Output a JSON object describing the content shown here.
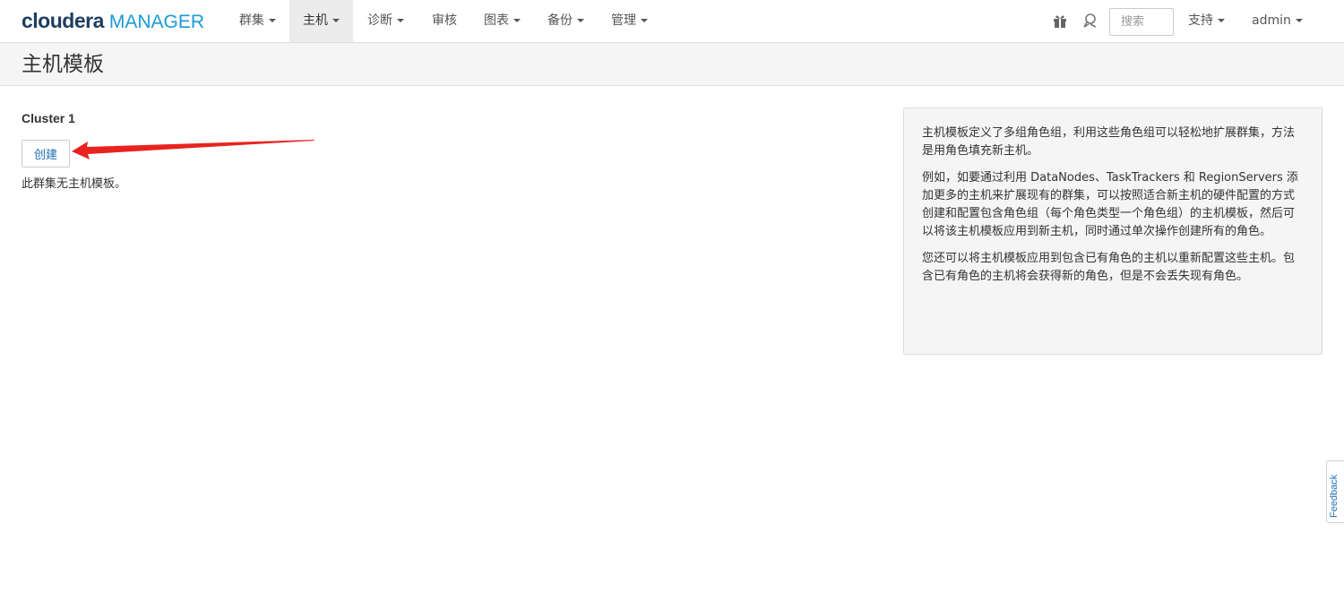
{
  "brand": {
    "name_part1": "cloudera",
    "name_part2": "MANAGER"
  },
  "nav": {
    "items": [
      {
        "label": "群集",
        "dropdown": true
      },
      {
        "label": "主机",
        "dropdown": true,
        "active": true
      },
      {
        "label": "诊断",
        "dropdown": true
      },
      {
        "label": "审核",
        "dropdown": false
      },
      {
        "label": "图表",
        "dropdown": true
      },
      {
        "label": "备份",
        "dropdown": true
      },
      {
        "label": "管理",
        "dropdown": true
      }
    ],
    "search_placeholder": "搜索",
    "support_label": "支持",
    "user_label": "admin"
  },
  "page": {
    "title": "主机模板",
    "cluster_name": "Cluster 1",
    "create_button": "创建",
    "empty_message": "此群集无主机模板。"
  },
  "info": {
    "paragraphs": [
      "主机模板定义了多组角色组，利用这些角色组可以轻松地扩展群集，方法是用角色填充新主机。",
      "例如，如要通过利用 DataNodes、TaskTrackers 和 RegionServers 添加更多的主机来扩展现有的群集，可以按照适合新主机的硬件配置的方式创建和配置包含角色组（每个角色类型一个角色组）的主机模板，然后可以将该主机模板应用到新主机，同时通过单次操作创建所有的角色。",
      "您还可以将主机模板应用到包含已有角色的主机以重新配置这些主机。包含已有角色的主机将会获得新的角色，但是不会丢失现有角色。"
    ]
  },
  "feedback_label": "Feedback",
  "icons": {
    "gift": "gift-icon",
    "support": "support-icon"
  },
  "colors": {
    "brand_dark": "#1d3d5f",
    "brand_accent": "#199ad6",
    "link": "#1f6fb3",
    "annotation_arrow": "#e8231f"
  }
}
